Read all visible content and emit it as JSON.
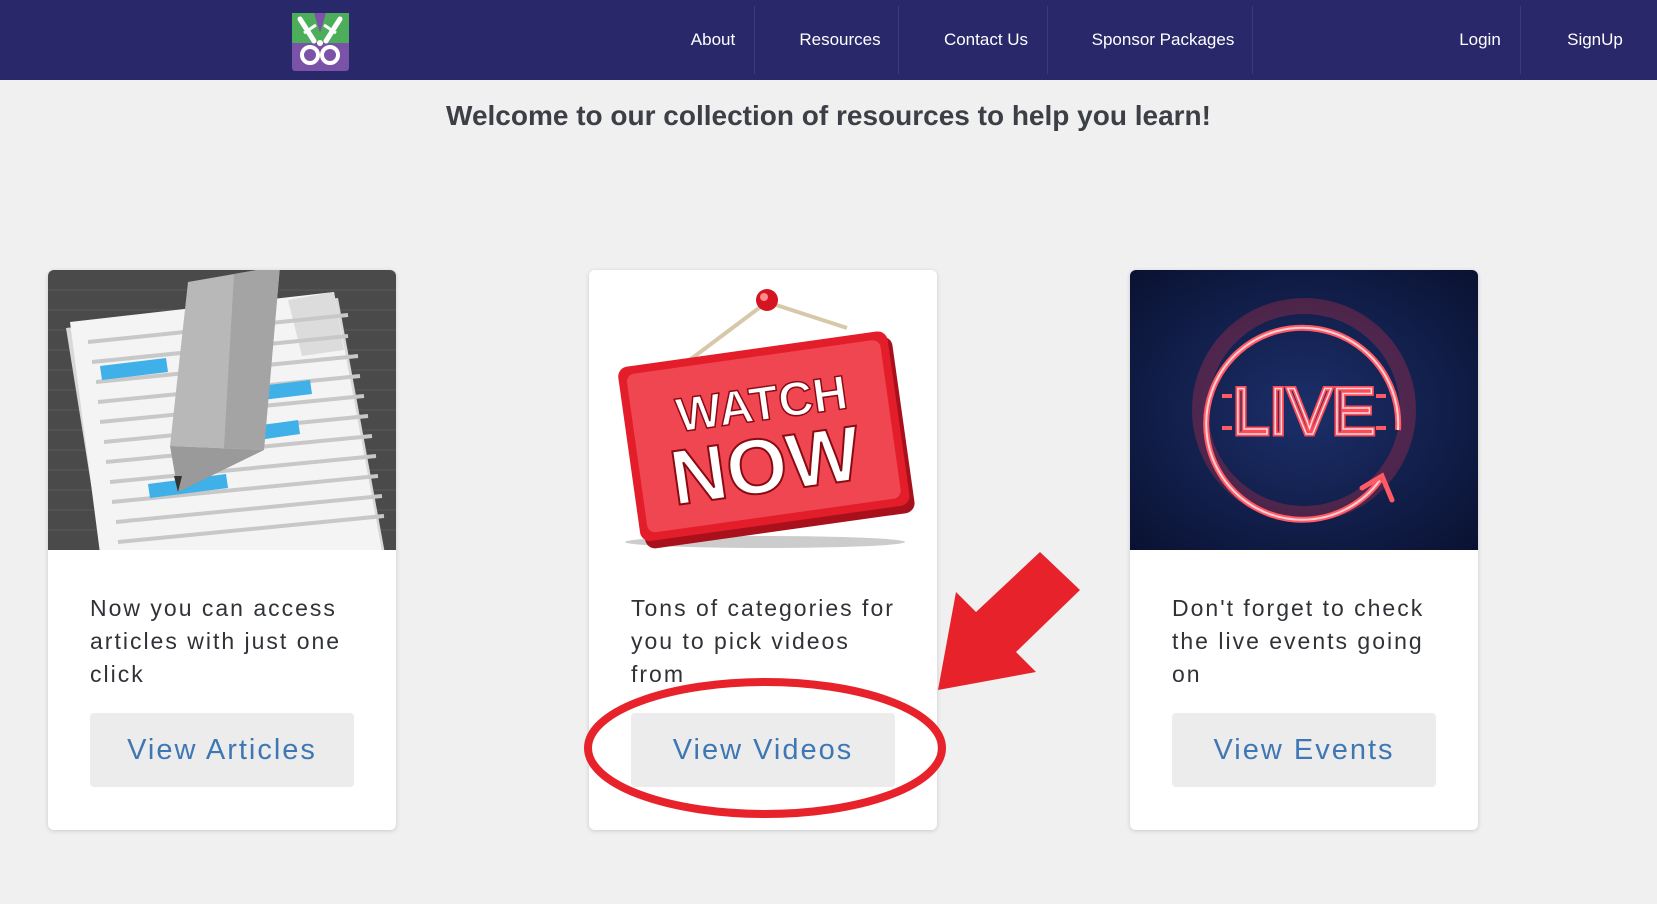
{
  "header": {
    "logo_icon": "scissors-logo-icon",
    "nav": [
      {
        "label": "About"
      },
      {
        "label": "Resources"
      },
      {
        "label": "Contact Us"
      },
      {
        "label": "Sponsor Packages"
      },
      {
        "label": "Login"
      },
      {
        "label": "SignUp"
      }
    ],
    "background_color": "#28286a"
  },
  "page_title": "Welcome to our collection of resources to help you learn!",
  "cards": [
    {
      "image": "article-document-pen-icon",
      "description": "Now you can access articles with just one click",
      "button_label": "View Articles"
    },
    {
      "image": "watch-now-sign-icon",
      "image_text": {
        "line1": "WATCH",
        "line2": "NOW"
      },
      "description": "Tons of categories for you to pick videos from",
      "button_label": "View Videos"
    },
    {
      "image": "live-neon-icon",
      "image_text": "LIVE",
      "description": "Don't forget to check the live events going on",
      "button_label": "View Events"
    }
  ],
  "annotation": {
    "arrow": "red-arrow-icon",
    "circle": "red-circle-highlight",
    "color": "#e8222a"
  },
  "colors": {
    "button_text": "#3f77b5",
    "button_bg": "#ececec",
    "page_bg": "#f0f0f0"
  }
}
